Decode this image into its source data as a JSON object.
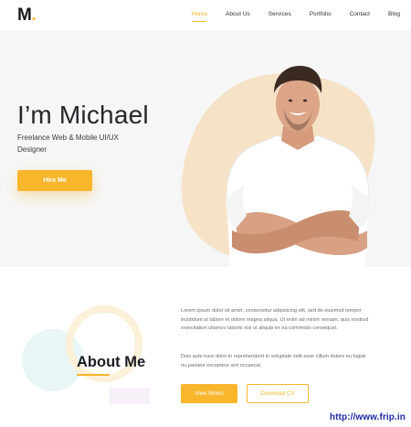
{
  "header": {
    "logo_text": "M",
    "logo_dot": ".",
    "nav": [
      {
        "label": "Home",
        "active": true
      },
      {
        "label": "About Us",
        "active": false
      },
      {
        "label": "Services",
        "active": false
      },
      {
        "label": "Portfolio",
        "active": false
      },
      {
        "label": "Contact",
        "active": false
      },
      {
        "label": "Blog",
        "active": false
      }
    ]
  },
  "hero": {
    "title": "I’m Michael",
    "subtitle": "Freelance Web & Mobile UI/UX Designer",
    "cta_label": "Hire Me"
  },
  "about": {
    "title": "About Me",
    "paragraph1": "Lorem ipsum dolor sit amet, consectetur adipisicing elit, sed do eiusmod tempor incididunt ut labore et dolore magna aliqua. Ut enim ad minim veniam, quis nostrud exercitation ullamco laboris nisi ut aliquip ex ea commodo consequat.",
    "paragraph2": "Duis aute irure dolor in reprehenderit in voluptate velit esse cillum dolore eu fugiat nu pariatur excepteur sint occaecat.",
    "view_works_label": "View Works",
    "download_cv_label": "Download CV"
  },
  "watermark": "http://www.frip.in",
  "colors": {
    "accent": "#f8b62c",
    "blob": "#f6e2c6",
    "hero_bg": "#f6f6f6",
    "text_dark": "#26262c",
    "watermark": "#1f2aa6"
  },
  "icons": [
    "portrait-photo",
    "decorative-circles"
  ]
}
